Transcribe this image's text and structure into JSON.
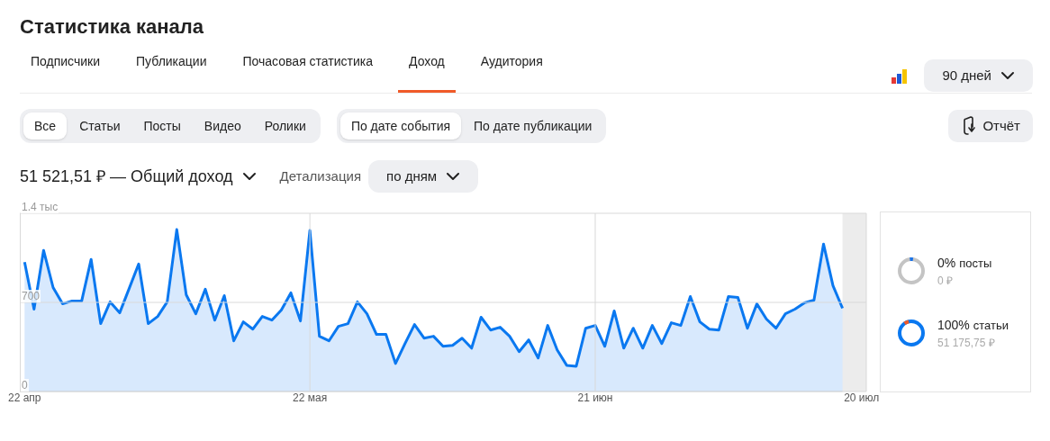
{
  "title": "Статистика канала",
  "tabs": [
    {
      "label": "Подписчики",
      "selected": false
    },
    {
      "label": "Публикации",
      "selected": false
    },
    {
      "label": "Почасовая статистика",
      "selected": false
    },
    {
      "label": "Доход",
      "selected": true
    },
    {
      "label": "Аудитория",
      "selected": false
    }
  ],
  "period": "90 дней",
  "content_filter": [
    {
      "label": "Все",
      "selected": true
    },
    {
      "label": "Статьи",
      "selected": false
    },
    {
      "label": "Посты",
      "selected": false
    },
    {
      "label": "Видео",
      "selected": false
    },
    {
      "label": "Ролики",
      "selected": false
    }
  ],
  "date_filter": [
    {
      "label": "По дате события",
      "selected": true
    },
    {
      "label": "По дате публикации",
      "selected": false
    }
  ],
  "report_button": "Отчёт",
  "total": "51 521,51 ₽ — Общий доход",
  "detail_label": "Детализация",
  "detail_value": "по дням",
  "chart_data": {
    "type": "area",
    "grid": true,
    "categories": [
      "22 апр",
      null,
      null,
      null,
      null,
      null,
      null,
      null,
      null,
      null,
      null,
      null,
      null,
      null,
      null,
      null,
      null,
      null,
      null,
      null,
      null,
      null,
      null,
      null,
      null,
      null,
      null,
      null,
      null,
      null,
      "22 мая",
      null,
      null,
      null,
      null,
      null,
      null,
      null,
      null,
      null,
      null,
      null,
      null,
      null,
      null,
      null,
      null,
      null,
      null,
      null,
      null,
      null,
      null,
      null,
      null,
      null,
      null,
      null,
      null,
      null,
      "21 июн",
      null,
      null,
      null,
      null,
      null,
      null,
      null,
      null,
      null,
      null,
      null,
      null,
      null,
      null,
      null,
      null,
      null,
      null,
      null,
      null,
      null,
      null,
      null,
      null,
      null,
      null,
      null,
      "20 июл"
    ],
    "ylim": [
      0,
      1400
    ],
    "yticks": [
      0,
      700
    ],
    "series": [
      {
        "color": "#0a78f0",
        "values": [
          1016,
          647,
          1109,
          817,
          689,
          711,
          711,
          1038,
          533,
          704,
          618,
          810,
          1002,
          533,
          590,
          704,
          1272,
          760,
          611,
          803,
          561,
          753,
          398,
          547,
          490,
          590,
          561,
          640,
          775,
          554,
          1265,
          434,
          398,
          512,
          533,
          704,
          611,
          448,
          448,
          220,
          377,
          526,
          419,
          434,
          355,
          362,
          419,
          341,
          583,
          483,
          505,
          434,
          313,
          405,
          263,
          519,
          327,
          206,
          199,
          497,
          519,
          355,
          633,
          341,
          497,
          341,
          519,
          377,
          540,
          519,
          746,
          547,
          490,
          483,
          746,
          739,
          497,
          689,
          569,
          497,
          611,
          647,
          697,
          718,
          1158,
          832,
          654,
          null,
          null
        ]
      }
    ]
  },
  "chart_top_label": "1.4 тыс",
  "shares": [
    {
      "percent": "0%",
      "label": "посты",
      "amount": "0 ₽",
      "kind": "empty",
      "color": "#1a73e8"
    },
    {
      "percent": "100%",
      "label": "статьи",
      "amount": "51 175,75 ₽",
      "kind": "full",
      "color": "#f05a28"
    }
  ]
}
